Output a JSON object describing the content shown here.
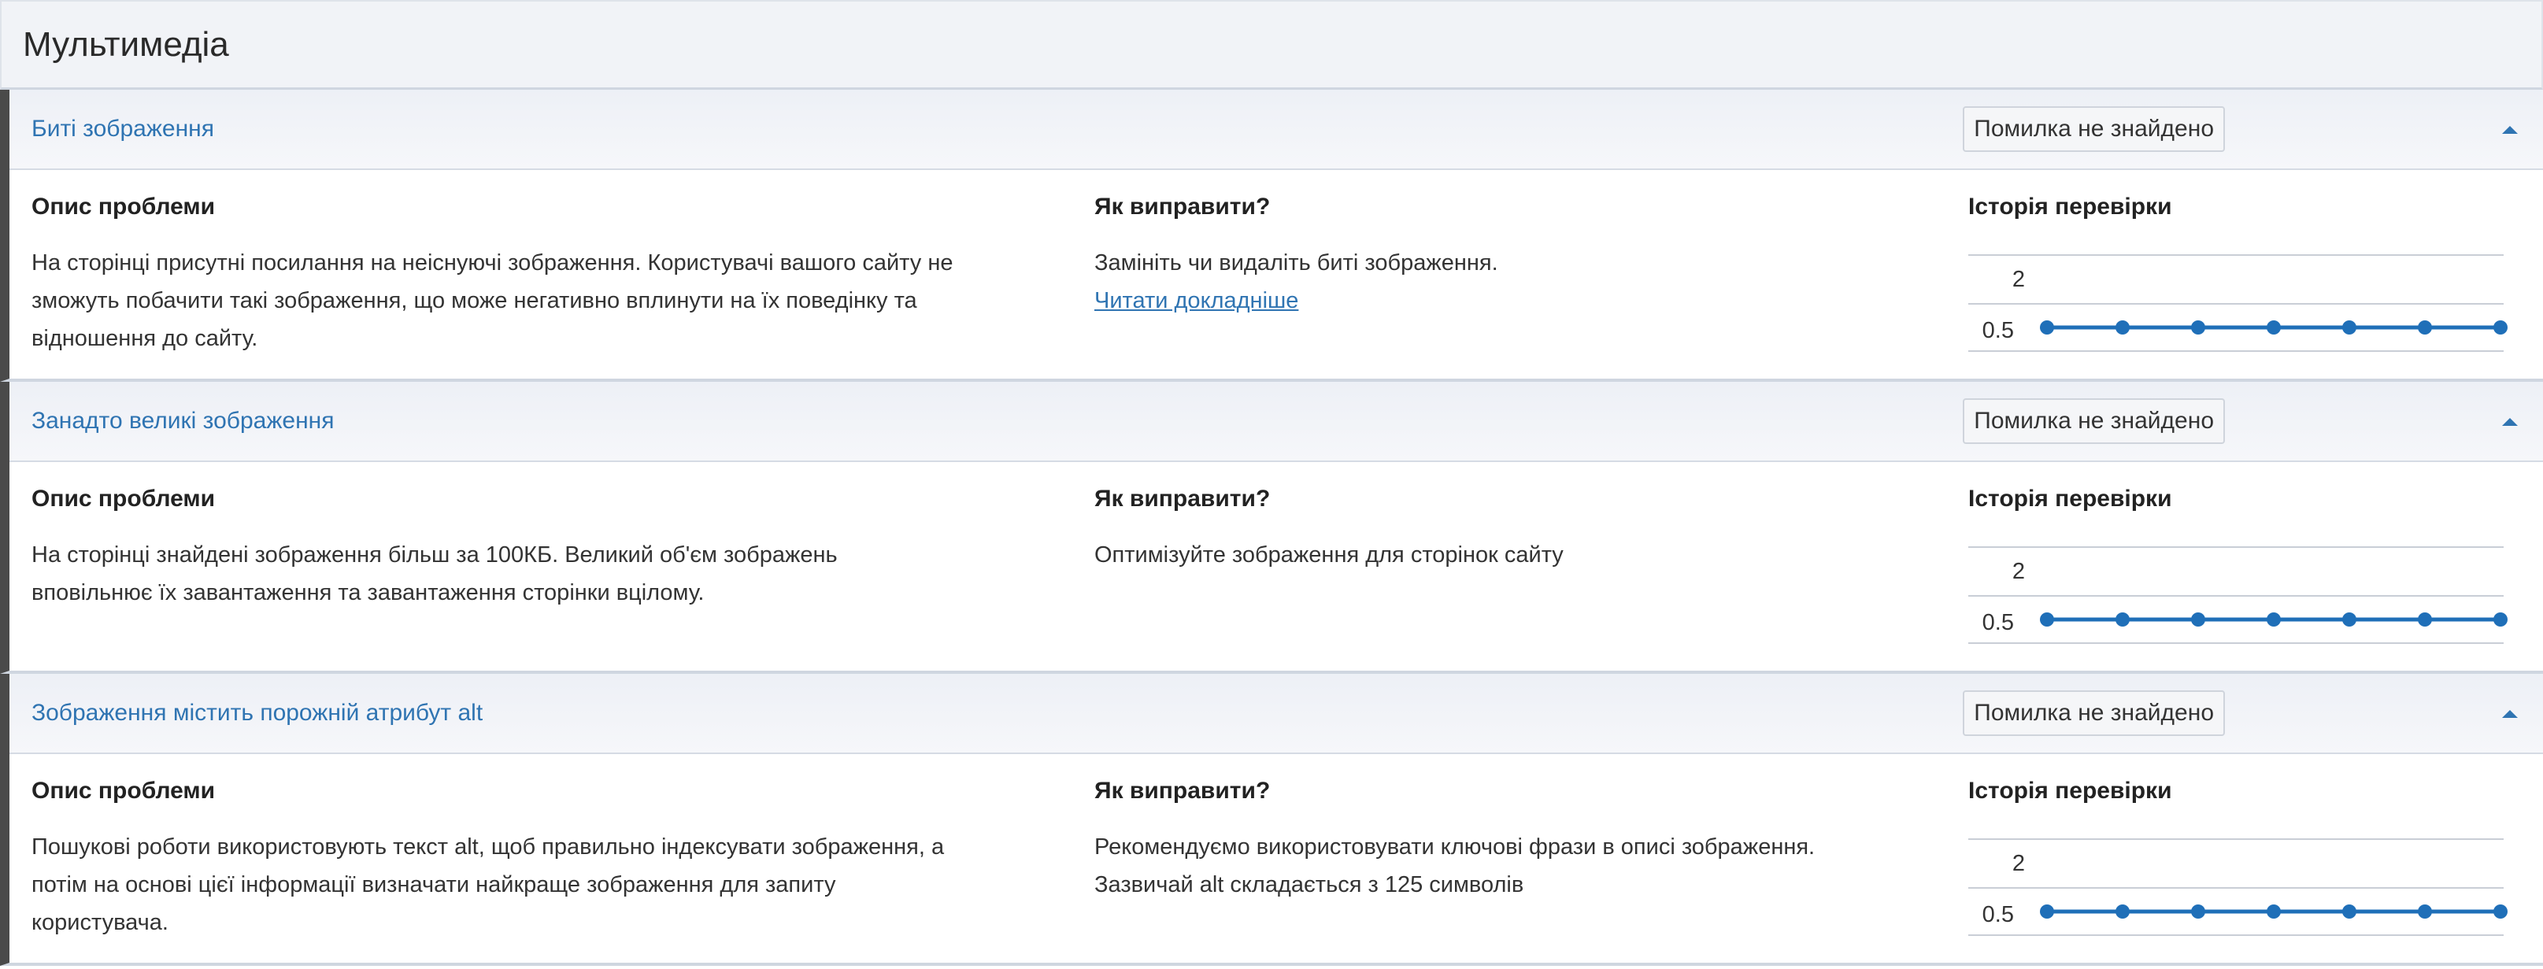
{
  "section": {
    "title": "Мультимедіа"
  },
  "issues": [
    {
      "title": "Биті зображення",
      "status": "Помилка не знайдено",
      "description_heading": "Опис проблеми",
      "description_lines": [
        "На сторінці присутні посилання на неіснуючі зображення. Користувачі вашого сайту не",
        "зможуть побачити такі зображення, що може негативно вплинути на їх поведінку та",
        "відношення до сайту."
      ],
      "fix_heading": "Як виправити?",
      "fix_lines": [
        "Замініть чи видаліть биті зображення."
      ],
      "read_more": "Читати докладніше",
      "history_heading": "Історія перевірки"
    },
    {
      "title": "Занадто великі зображення",
      "status": "Помилка не знайдено",
      "description_heading": "Опис проблеми",
      "description_lines": [
        "На сторінці знайдені зображення більш за 100КБ. Великий об'єм зображень",
        "вповільнює їх завантаження та завантаження сторінки вцілому."
      ],
      "fix_heading": "Як виправити?",
      "fix_lines": [
        "Оптимізуйте зображення для сторінок сайту"
      ],
      "read_more": "",
      "history_heading": "Історія перевірки"
    },
    {
      "title": "Зображення містить порожній атрибут alt",
      "status": "Помилка не знайдено",
      "description_heading": "Опис проблеми",
      "description_lines": [
        "Пошукові роботи використовують текст alt, щоб правильно індексувати зображення, а",
        "потім на основі цієї інформації визначати найкраще зображення для запиту",
        "користувача."
      ],
      "fix_heading": "Як виправити?",
      "fix_lines": [
        "Рекомендуємо використовувати ключові фрази в описі зображення.",
        "Зазвичай alt складається з 125 символів"
      ],
      "read_more": "",
      "history_heading": "Історія перевірки"
    }
  ],
  "colors": {
    "accent": "#2f74b2",
    "line": "#1f6fb8",
    "border": "#4a4a4a"
  },
  "chart_data": [
    {
      "type": "line",
      "y_ticks": [
        "2",
        "0.5"
      ],
      "series": [
        {
          "values": [
            0,
            0,
            0,
            0,
            0,
            0,
            0
          ]
        }
      ]
    },
    {
      "type": "line",
      "y_ticks": [
        "2",
        "0.5"
      ],
      "series": [
        {
          "values": [
            0,
            0,
            0,
            0,
            0,
            0,
            0
          ]
        }
      ]
    },
    {
      "type": "line",
      "y_ticks": [
        "2",
        "0.5"
      ],
      "series": [
        {
          "values": [
            0,
            0,
            0,
            0,
            0,
            0,
            0
          ]
        }
      ]
    }
  ]
}
